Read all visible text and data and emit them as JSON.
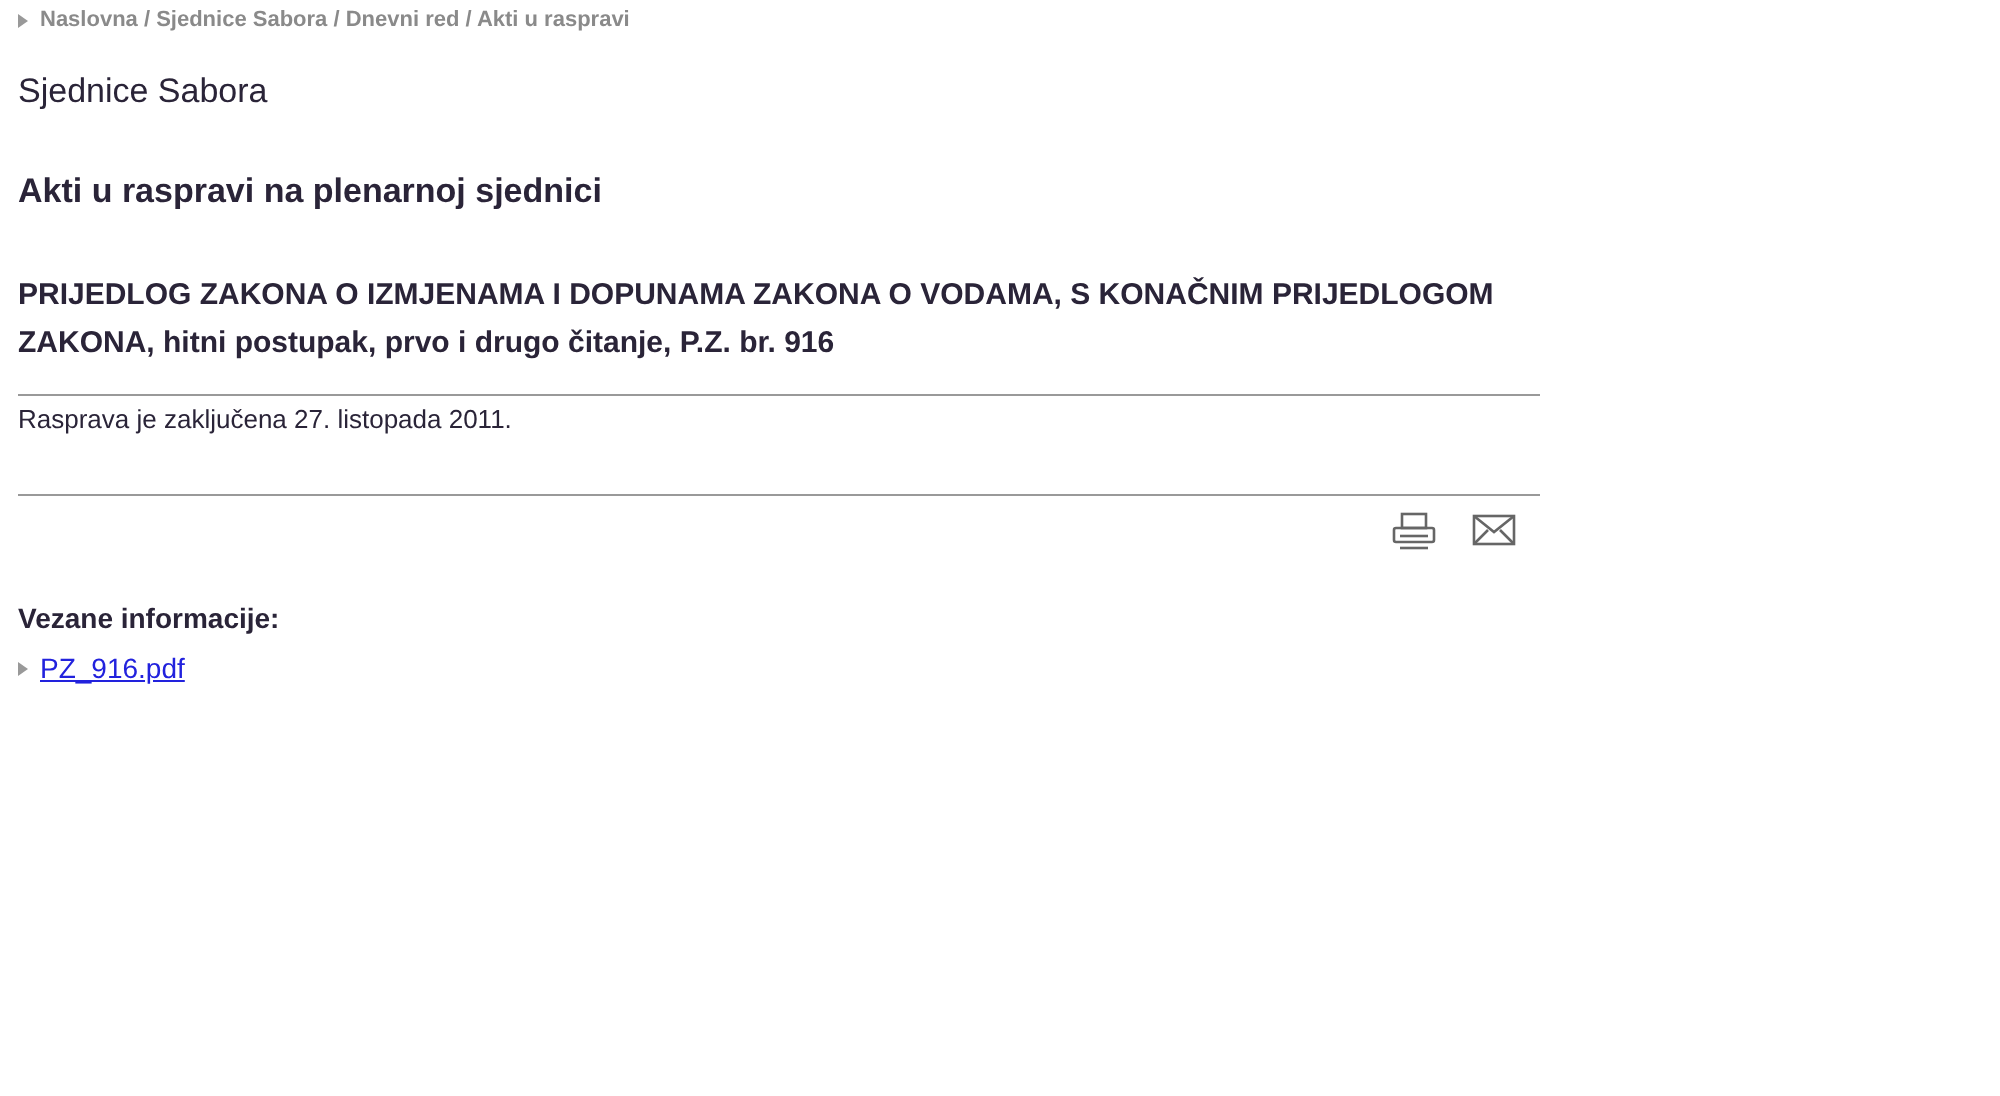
{
  "breadcrumb": "Naslovna / Sjednice Sabora / Dnevni red / Akti u raspravi",
  "section_title": "Sjednice Sabora",
  "page_title": "Akti u raspravi na plenarnoj sjednici",
  "act_title": "PRIJEDLOG ZAKONA O IZMJENAMA I DOPUNAMA ZAKONA O VODAMA, S KONAČNIM PRIJEDLOGOM ZAKONA, hitni postupak, prvo i drugo čitanje, P.Z. br. 916",
  "status": "Rasprava je zaključena 27. listopada 2011.",
  "related": {
    "heading": "Vezane informacije:",
    "links": [
      "PZ_916.pdf"
    ]
  }
}
